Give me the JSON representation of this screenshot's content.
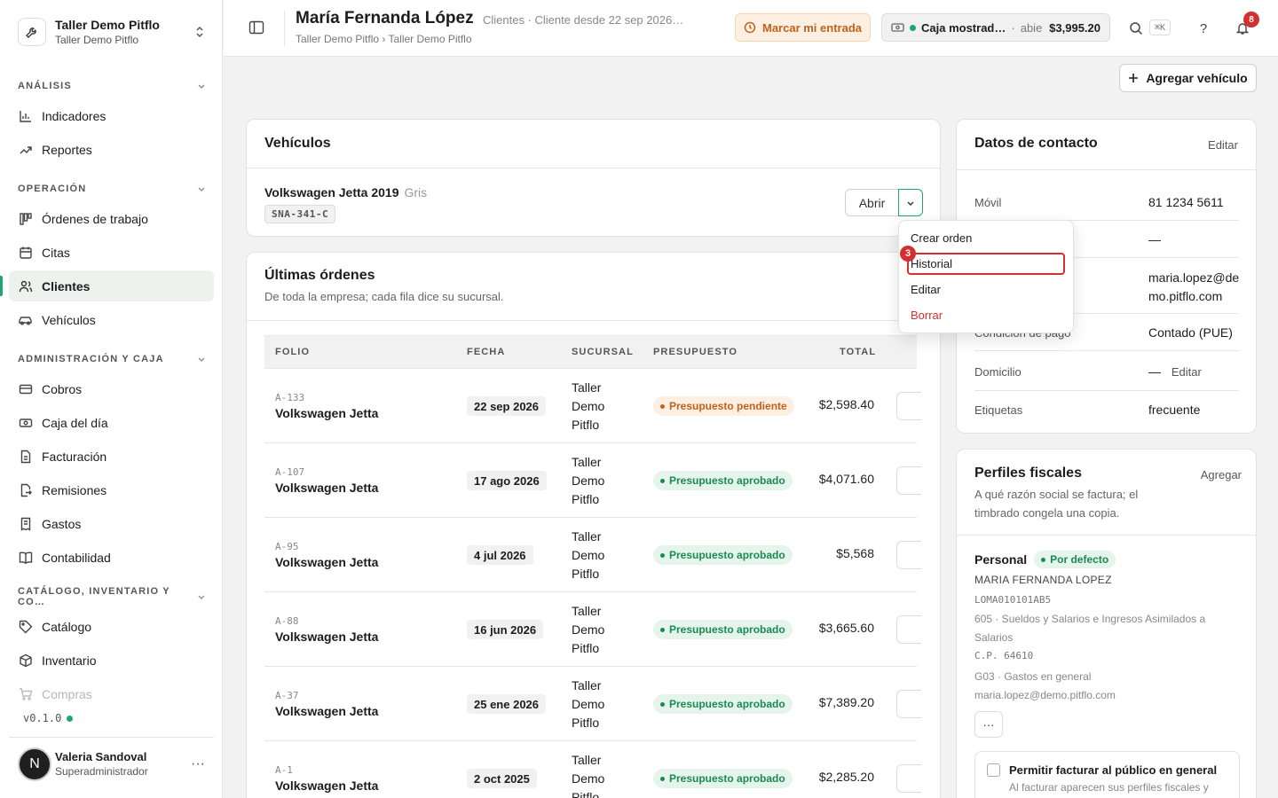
{
  "org": {
    "name": "Taller Demo Pitflo",
    "sub": "Taller Demo Pitflo"
  },
  "sidebar": {
    "sections": [
      {
        "title": "ANÁLISIS"
      },
      {
        "title": "OPERACIÓN"
      },
      {
        "title": "ADMINISTRACIÓN Y CAJA"
      },
      {
        "title": "CATÁLOGO, INVENTARIO Y CO…"
      }
    ],
    "items": [
      {
        "label": "Indicadores",
        "icon": "bar-chart-icon"
      },
      {
        "label": "Reportes",
        "icon": "trend-up-icon"
      },
      {
        "label": "Órdenes de trabajo",
        "icon": "kanban-icon"
      },
      {
        "label": "Citas",
        "icon": "calendar-icon"
      },
      {
        "label": "Clientes",
        "icon": "users-icon"
      },
      {
        "label": "Vehículos",
        "icon": "car-icon"
      },
      {
        "label": "Cobros",
        "icon": "credit-card-icon"
      },
      {
        "label": "Caja del día",
        "icon": "cash-register-icon"
      },
      {
        "label": "Facturación",
        "icon": "document-icon"
      },
      {
        "label": "Remisiones",
        "icon": "file-export-icon"
      },
      {
        "label": "Gastos",
        "icon": "receipt-icon"
      },
      {
        "label": "Contabilidad",
        "icon": "book-icon"
      },
      {
        "label": "Catálogo",
        "icon": "tag-icon"
      },
      {
        "label": "Inventario",
        "icon": "box-icon"
      },
      {
        "label": "Compras",
        "icon": "cart-icon"
      }
    ],
    "version": "v0.1.0"
  },
  "user": {
    "initial": "N",
    "name": "Valeria Sandoval",
    "role": "Superadministrador"
  },
  "header": {
    "title": "María Fernanda López",
    "meta": "Clientes · Cliente desde 22 sep 2026…",
    "breadcrumb": "Taller Demo Pitflo › Taller Demo Pitflo",
    "entry_button": "Marcar mi entrada",
    "cash": {
      "name": "Caja mostrad…",
      "status": "abie",
      "amount": "$3,995.20"
    },
    "shortcut": "⌘K",
    "notifications": "8"
  },
  "add_vehicle_button": "Agregar vehículo",
  "vehicles": {
    "title": "Vehículos",
    "item": {
      "name": "Volkswagen Jetta 2019",
      "color": "Gris",
      "plate": "SNA-341-C",
      "open_label": "Abrir"
    }
  },
  "menu": {
    "items": [
      "Crear orden",
      "Historial",
      "Editar",
      "Borrar"
    ],
    "step": "3"
  },
  "orders": {
    "title": "Últimas órdenes",
    "subtitle": "De toda la empresa; cada fila dice su sucursal.",
    "headers": [
      "FOLIO",
      "FECHA",
      "SUCURSAL",
      "PRESUPUESTO",
      "TOTAL"
    ],
    "rows": [
      {
        "folio": "A-133",
        "vehicle": "Volkswagen Jetta",
        "date": "22 sep 2026",
        "branch": "Taller Demo Pitflo",
        "status": "Presupuesto pendiente",
        "status_kind": "pending",
        "total": "$2,598.40"
      },
      {
        "folio": "A-107",
        "vehicle": "Volkswagen Jetta",
        "date": "17 ago 2026",
        "branch": "Taller Demo Pitflo",
        "status": "Presupuesto aprobado",
        "status_kind": "ok",
        "total": "$4,071.60"
      },
      {
        "folio": "A-95",
        "vehicle": "Volkswagen Jetta",
        "date": "4 jul 2026",
        "branch": "Taller Demo Pitflo",
        "status": "Presupuesto aprobado",
        "status_kind": "ok",
        "total": "$5,568"
      },
      {
        "folio": "A-88",
        "vehicle": "Volkswagen Jetta",
        "date": "16 jun 2026",
        "branch": "Taller Demo Pitflo",
        "status": "Presupuesto aprobado",
        "status_kind": "ok",
        "total": "$3,665.60"
      },
      {
        "folio": "A-37",
        "vehicle": "Volkswagen Jetta",
        "date": "25 ene 2026",
        "branch": "Taller Demo Pitflo",
        "status": "Presupuesto aprobado",
        "status_kind": "ok",
        "total": "$7,389.20"
      },
      {
        "folio": "A-1",
        "vehicle": "Volkswagen Jetta",
        "date": "2 oct 2025",
        "branch": "Taller Demo Pitflo",
        "status": "Presupuesto aprobado",
        "status_kind": "ok",
        "total": "$2,285.20"
      }
    ]
  },
  "contact": {
    "title": "Datos de contacto",
    "edit": "Editar",
    "mobile_label": "Móvil",
    "mobile": "81 1234 5611",
    "phone_value": "—",
    "email_value": "maria.lopez@demo.pitflo.com",
    "payment_label": "Condición de pago",
    "payment": "Contado (PUE)",
    "address_label": "Domicilio",
    "address_value": "—",
    "address_edit": "Editar",
    "tags_label": "Etiquetas",
    "tags": "frecuente"
  },
  "fiscal": {
    "title": "Perfiles fiscales",
    "add": "Agregar",
    "subtitle": "A qué razón social se factura; el timbrado congela una copia.",
    "profile": {
      "name": "Personal",
      "default_label": "Por defecto",
      "legal_name": "MARIA FERNANDA LOPEZ",
      "rfc": "LOMA010101AB5",
      "regime": "605 · Sueldos y Salarios e Ingresos Asimilados a Salarios",
      "cp": "C.P. 64610",
      "use": "G03 · Gastos en general",
      "email": "maria.lopez@demo.pitflo.com"
    },
    "more": "···",
    "public_title": "Permitir facturar al público en general",
    "public_sub": "Al facturar aparecen sus perfiles fiscales y"
  }
}
